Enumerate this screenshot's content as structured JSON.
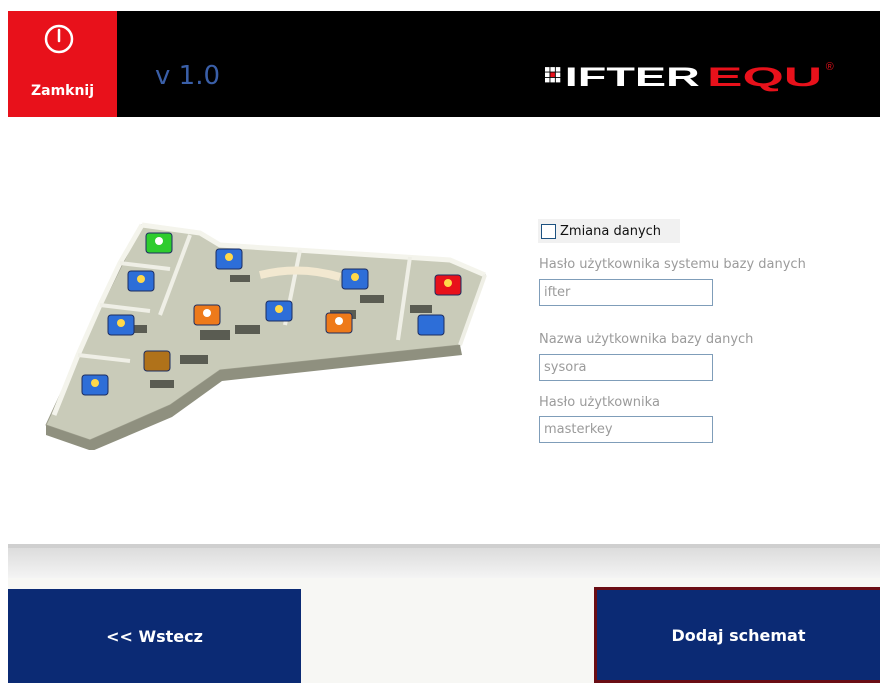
{
  "header": {
    "close_label": "Zamknij",
    "version": "v 1.0",
    "logo_prefix": "IFTER",
    "logo_suffix": "EQU",
    "logo_mark": "®"
  },
  "icons": {
    "close": "power-icon",
    "logo": "ifter-grid-icon"
  },
  "form": {
    "change_data_label": "Zmiana danych",
    "change_data_checked": false,
    "db_system_password_label": "Hasło użytkownika systemu bazy danych",
    "db_system_password_value": "ifter",
    "db_user_name_label": "Nazwa użytkownika bazy danych",
    "db_user_name_value": "sysora",
    "user_password_label": "Hasło użytkownika",
    "user_password_value": "masterkey"
  },
  "footer": {
    "back_label": "<< Wstecz",
    "add_label": "Dodaj schemat"
  },
  "colors": {
    "header_bg": "#000000",
    "close_bg": "#e8111b",
    "button_bg": "#0b2a74",
    "version": "#3a5fa8",
    "logo_red": "#e8111b"
  }
}
